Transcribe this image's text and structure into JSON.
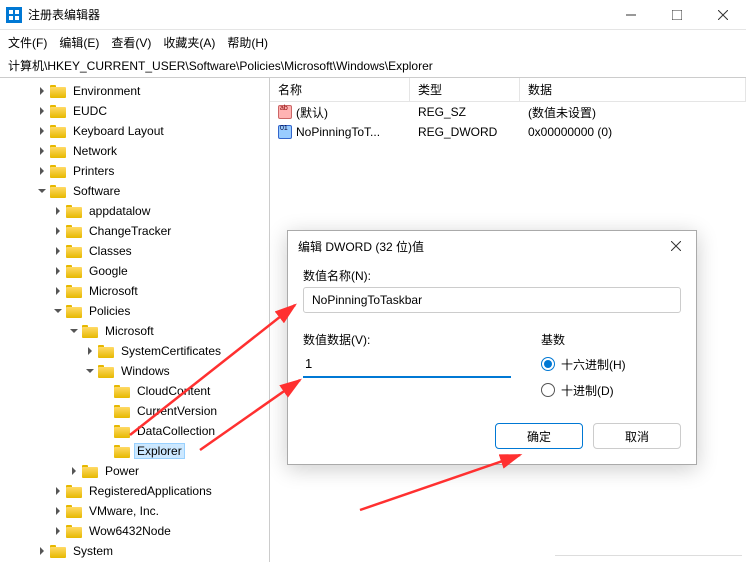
{
  "window": {
    "title": "注册表编辑器"
  },
  "menu": {
    "file": "文件(F)",
    "edit": "编辑(E)",
    "view": "查看(V)",
    "favorites": "收藏夹(A)",
    "help": "帮助(H)"
  },
  "address": "计算机\\HKEY_CURRENT_USER\\Software\\Policies\\Microsoft\\Windows\\Explorer",
  "tree": [
    {
      "indent": 2,
      "caret": "closed",
      "label": "Environment"
    },
    {
      "indent": 2,
      "caret": "closed",
      "label": "EUDC"
    },
    {
      "indent": 2,
      "caret": "closed",
      "label": "Keyboard Layout"
    },
    {
      "indent": 2,
      "caret": "closed",
      "label": "Network"
    },
    {
      "indent": 2,
      "caret": "closed",
      "label": "Printers"
    },
    {
      "indent": 2,
      "caret": "open",
      "label": "Software"
    },
    {
      "indent": 3,
      "caret": "closed",
      "label": "appdatalow"
    },
    {
      "indent": 3,
      "caret": "closed",
      "label": "ChangeTracker"
    },
    {
      "indent": 3,
      "caret": "closed",
      "label": "Classes"
    },
    {
      "indent": 3,
      "caret": "closed",
      "label": "Google"
    },
    {
      "indent": 3,
      "caret": "closed",
      "label": "Microsoft"
    },
    {
      "indent": 3,
      "caret": "open",
      "label": "Policies"
    },
    {
      "indent": 4,
      "caret": "open",
      "label": "Microsoft"
    },
    {
      "indent": 5,
      "caret": "closed",
      "label": "SystemCertificates"
    },
    {
      "indent": 5,
      "caret": "open",
      "label": "Windows"
    },
    {
      "indent": 6,
      "caret": "none",
      "label": "CloudContent"
    },
    {
      "indent": 6,
      "caret": "none",
      "label": "CurrentVersion"
    },
    {
      "indent": 6,
      "caret": "none",
      "label": "DataCollection"
    },
    {
      "indent": 6,
      "caret": "none",
      "label": "Explorer",
      "selected": true
    },
    {
      "indent": 4,
      "caret": "closed",
      "label": "Power"
    },
    {
      "indent": 3,
      "caret": "closed",
      "label": "RegisteredApplications"
    },
    {
      "indent": 3,
      "caret": "closed",
      "label": "VMware, Inc."
    },
    {
      "indent": 3,
      "caret": "closed",
      "label": "Wow6432Node"
    },
    {
      "indent": 2,
      "caret": "closed",
      "label": "System"
    }
  ],
  "list": {
    "headers": {
      "name": "名称",
      "type": "类型",
      "data": "数据"
    },
    "rows": [
      {
        "icon": "str",
        "name": "(默认)",
        "type": "REG_SZ",
        "data": "(数值未设置)"
      },
      {
        "icon": "num",
        "name": "NoPinningToT...",
        "type": "REG_DWORD",
        "data": "0x00000000 (0)"
      }
    ]
  },
  "dialog": {
    "title": "编辑 DWORD (32 位)值",
    "name_label": "数值名称(N):",
    "name_value": "NoPinningToTaskbar",
    "data_label": "数值数据(V):",
    "data_value": "1",
    "base_label": "基数",
    "hex_label": "十六进制(H)",
    "dec_label": "十进制(D)",
    "ok": "确定",
    "cancel": "取消"
  }
}
